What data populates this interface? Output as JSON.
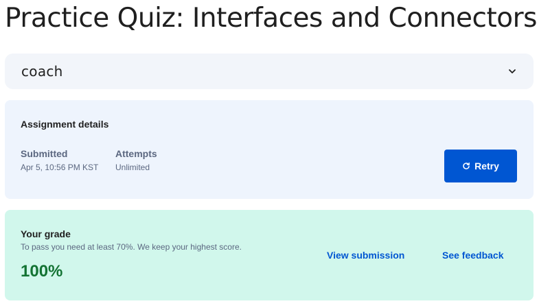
{
  "page": {
    "title": "Practice Quiz: Interfaces and Connectors"
  },
  "coach": {
    "label": "coach",
    "toggle_icon": "chevron-down-icon"
  },
  "assignment": {
    "heading": "Assignment details",
    "submitted": {
      "label": "Submitted",
      "value": "Apr 5, 10:56 PM KST"
    },
    "attempts": {
      "label": "Attempts",
      "value": "Unlimited"
    },
    "retry_label": "Retry",
    "retry_icon": "refresh-icon",
    "retry_color": "#0056d2"
  },
  "grade": {
    "heading": "Your grade",
    "requirement": "To pass you need at least 70%. We keep your highest score.",
    "score": "100%",
    "score_color": "#137333",
    "background_color": "#d1f7ec",
    "view_submission_label": "View submission",
    "see_feedback_label": "See feedback"
  }
}
